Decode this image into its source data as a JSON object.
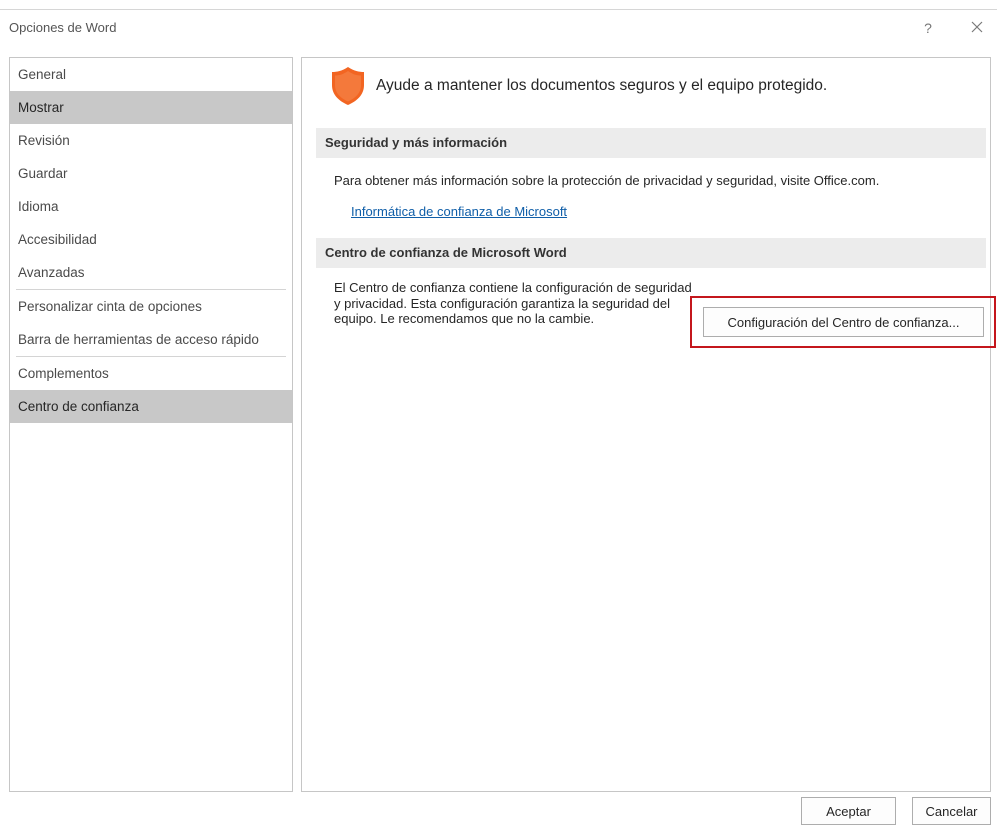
{
  "window": {
    "title": "Opciones de Word",
    "help_label": "?"
  },
  "sidebar": {
    "items": [
      {
        "label": "General"
      },
      {
        "label": "Mostrar"
      },
      {
        "label": "Revisión"
      },
      {
        "label": "Guardar"
      },
      {
        "label": "Idioma"
      },
      {
        "label": "Accesibilidad"
      },
      {
        "label": "Avanzadas"
      },
      {
        "label": "Personalizar cinta de opciones"
      },
      {
        "label": "Barra de herramientas de acceso rápido"
      },
      {
        "label": "Complementos"
      },
      {
        "label": "Centro de confianza"
      }
    ]
  },
  "main": {
    "hero_text": "Ayude a mantener los documentos seguros y el equipo protegido.",
    "sec1": {
      "heading": "Seguridad y más información",
      "text": "Para obtener más información sobre la protección de privacidad y seguridad, visite Office.com.",
      "link": "Informática de confianza de Microsoft"
    },
    "sec2": {
      "heading": "Centro de confianza de Microsoft Word",
      "text": "El Centro de confianza contiene la configuración de seguridad y privacidad. Esta configuración garantiza la seguridad del equipo. Le recomendamos que no la cambie.",
      "button": "Configuración del Centro de confianza..."
    }
  },
  "footer": {
    "ok": "Aceptar",
    "cancel": "Cancelar"
  },
  "colors": {
    "accent_red": "#c4161c",
    "shield_orange": "#f26522",
    "link_blue": "#0f5ea8",
    "selection_gray": "#c8c8c8"
  }
}
